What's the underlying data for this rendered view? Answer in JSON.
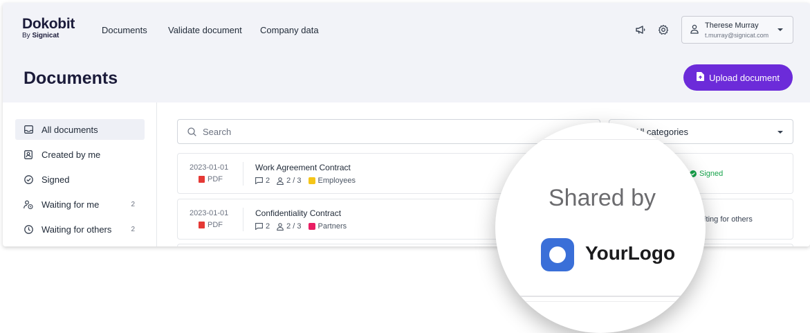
{
  "brand": {
    "name": "Dokobit",
    "sub_prefix": "By",
    "sub_name": "Signicat"
  },
  "nav": {
    "documents": "Documents",
    "validate": "Validate document",
    "company": "Company data"
  },
  "icons": {
    "announce": "megaphone-icon",
    "settings": "gear-icon",
    "user": "user-icon"
  },
  "user": {
    "name": "Therese Murray",
    "email": "t.murray@signicat.com"
  },
  "page": {
    "title": "Documents",
    "upload_label": "Upload document"
  },
  "colors": {
    "accent": "#6c2bd9",
    "signed": "#16a34a",
    "employees_tag": "#f5c518",
    "partners_tag": "#e91e63",
    "pdf": "#e53935"
  },
  "sidebar": {
    "items": [
      {
        "label": "All documents",
        "count": ""
      },
      {
        "label": "Created by me",
        "count": ""
      },
      {
        "label": "Signed",
        "count": ""
      },
      {
        "label": "Waiting for me",
        "count": "2"
      },
      {
        "label": "Waiting for others",
        "count": "2"
      }
    ]
  },
  "search": {
    "placeholder": "Search"
  },
  "filter": {
    "category": "All categories"
  },
  "documents": [
    {
      "date": "2023-01-01",
      "type": "PDF",
      "title": "Work Agreement Contract",
      "comments": "2",
      "signers": "2 / 3",
      "category": "Employees",
      "status": "Signed"
    },
    {
      "date": "2023-01-01",
      "type": "PDF",
      "title": "Confidentiality Contract",
      "comments": "2",
      "signers": "2 / 3",
      "category": "Partners",
      "status": "aiting for others"
    }
  ],
  "magnifier": {
    "shared_by": "Shared by",
    "logo_text": "YourLogo"
  }
}
